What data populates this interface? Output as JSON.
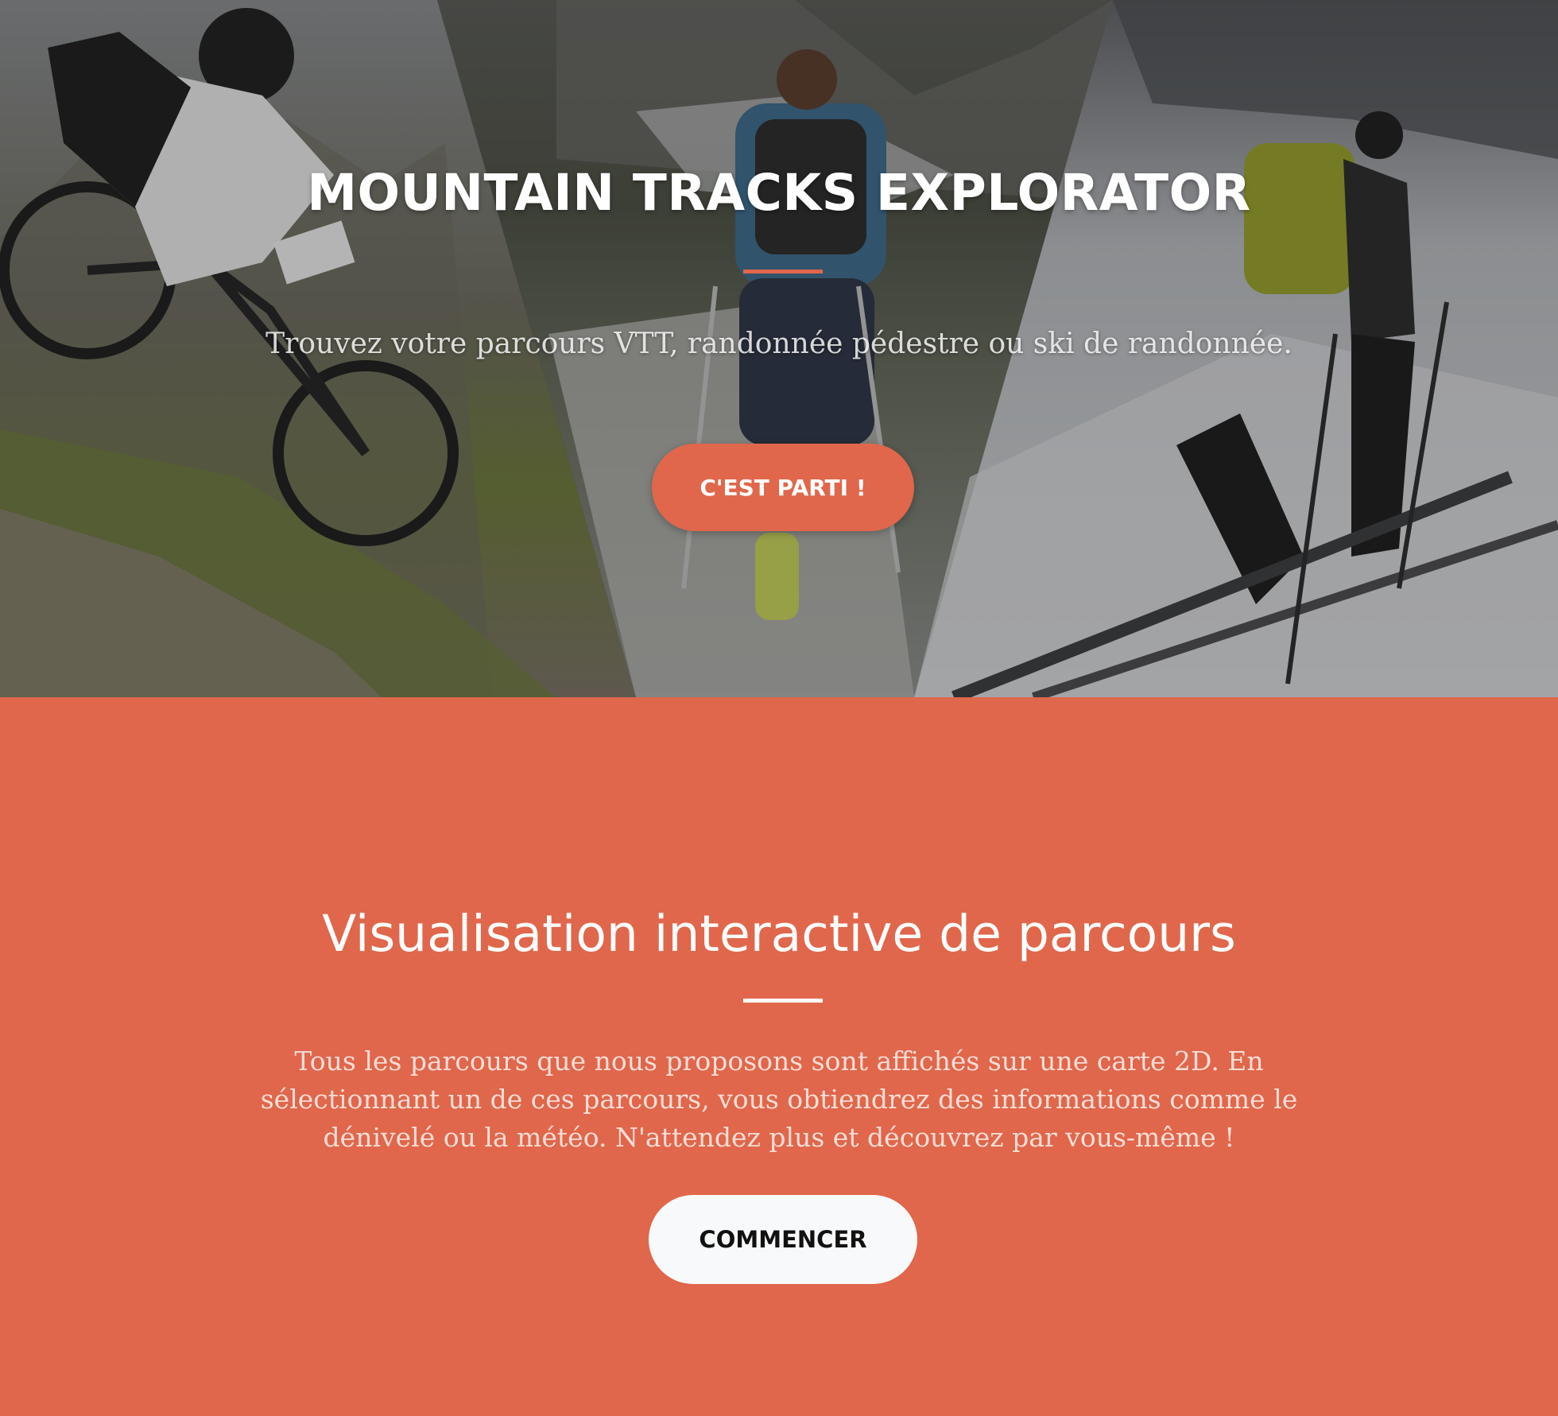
{
  "hero": {
    "title": "MOUNTAIN TRACKS EXPLORATOR",
    "subtitle": "Trouvez votre parcours VTT, randonnée pédestre ou ski de randonnée.",
    "cta_label": "C'EST PARTI !",
    "photos": [
      "vtt-rider-photo",
      "hiker-photo",
      "ski-touring-photo"
    ]
  },
  "about": {
    "title": "Visualisation interactive de parcours",
    "text": "Tous les parcours que nous proposons sont affichés sur une carte 2D. En sélectionnant un de ces parcours, vous obtiendrez des informations comme le dénivelé ou la météo. N'attendez plus et découvrez par vous-même !",
    "cta_label": "COMMENCER"
  },
  "colors": {
    "accent": "#e0674b",
    "button_light": "#f8f9fa",
    "text_dark": "#111111"
  }
}
